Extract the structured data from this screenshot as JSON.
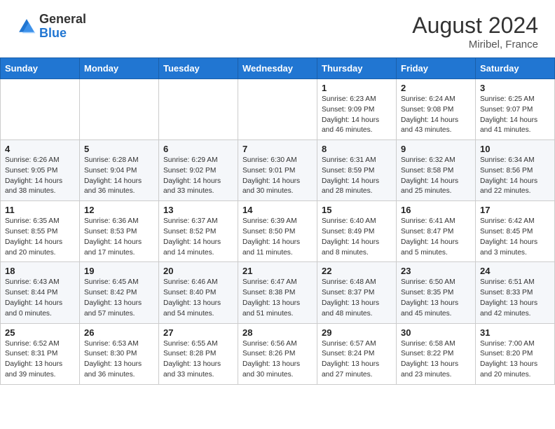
{
  "header": {
    "logo_general": "General",
    "logo_blue": "Blue",
    "month_title": "August 2024",
    "location": "Miribel, France"
  },
  "days_of_week": [
    "Sunday",
    "Monday",
    "Tuesday",
    "Wednesday",
    "Thursday",
    "Friday",
    "Saturday"
  ],
  "weeks": [
    [
      {
        "day": "",
        "content": ""
      },
      {
        "day": "",
        "content": ""
      },
      {
        "day": "",
        "content": ""
      },
      {
        "day": "",
        "content": ""
      },
      {
        "day": "1",
        "content": "Sunrise: 6:23 AM\nSunset: 9:09 PM\nDaylight: 14 hours\nand 46 minutes."
      },
      {
        "day": "2",
        "content": "Sunrise: 6:24 AM\nSunset: 9:08 PM\nDaylight: 14 hours\nand 43 minutes."
      },
      {
        "day": "3",
        "content": "Sunrise: 6:25 AM\nSunset: 9:07 PM\nDaylight: 14 hours\nand 41 minutes."
      }
    ],
    [
      {
        "day": "4",
        "content": "Sunrise: 6:26 AM\nSunset: 9:05 PM\nDaylight: 14 hours\nand 38 minutes."
      },
      {
        "day": "5",
        "content": "Sunrise: 6:28 AM\nSunset: 9:04 PM\nDaylight: 14 hours\nand 36 minutes."
      },
      {
        "day": "6",
        "content": "Sunrise: 6:29 AM\nSunset: 9:02 PM\nDaylight: 14 hours\nand 33 minutes."
      },
      {
        "day": "7",
        "content": "Sunrise: 6:30 AM\nSunset: 9:01 PM\nDaylight: 14 hours\nand 30 minutes."
      },
      {
        "day": "8",
        "content": "Sunrise: 6:31 AM\nSunset: 8:59 PM\nDaylight: 14 hours\nand 28 minutes."
      },
      {
        "day": "9",
        "content": "Sunrise: 6:32 AM\nSunset: 8:58 PM\nDaylight: 14 hours\nand 25 minutes."
      },
      {
        "day": "10",
        "content": "Sunrise: 6:34 AM\nSunset: 8:56 PM\nDaylight: 14 hours\nand 22 minutes."
      }
    ],
    [
      {
        "day": "11",
        "content": "Sunrise: 6:35 AM\nSunset: 8:55 PM\nDaylight: 14 hours\nand 20 minutes."
      },
      {
        "day": "12",
        "content": "Sunrise: 6:36 AM\nSunset: 8:53 PM\nDaylight: 14 hours\nand 17 minutes."
      },
      {
        "day": "13",
        "content": "Sunrise: 6:37 AM\nSunset: 8:52 PM\nDaylight: 14 hours\nand 14 minutes."
      },
      {
        "day": "14",
        "content": "Sunrise: 6:39 AM\nSunset: 8:50 PM\nDaylight: 14 hours\nand 11 minutes."
      },
      {
        "day": "15",
        "content": "Sunrise: 6:40 AM\nSunset: 8:49 PM\nDaylight: 14 hours\nand 8 minutes."
      },
      {
        "day": "16",
        "content": "Sunrise: 6:41 AM\nSunset: 8:47 PM\nDaylight: 14 hours\nand 5 minutes."
      },
      {
        "day": "17",
        "content": "Sunrise: 6:42 AM\nSunset: 8:45 PM\nDaylight: 14 hours\nand 3 minutes."
      }
    ],
    [
      {
        "day": "18",
        "content": "Sunrise: 6:43 AM\nSunset: 8:44 PM\nDaylight: 14 hours\nand 0 minutes."
      },
      {
        "day": "19",
        "content": "Sunrise: 6:45 AM\nSunset: 8:42 PM\nDaylight: 13 hours\nand 57 minutes."
      },
      {
        "day": "20",
        "content": "Sunrise: 6:46 AM\nSunset: 8:40 PM\nDaylight: 13 hours\nand 54 minutes."
      },
      {
        "day": "21",
        "content": "Sunrise: 6:47 AM\nSunset: 8:38 PM\nDaylight: 13 hours\nand 51 minutes."
      },
      {
        "day": "22",
        "content": "Sunrise: 6:48 AM\nSunset: 8:37 PM\nDaylight: 13 hours\nand 48 minutes."
      },
      {
        "day": "23",
        "content": "Sunrise: 6:50 AM\nSunset: 8:35 PM\nDaylight: 13 hours\nand 45 minutes."
      },
      {
        "day": "24",
        "content": "Sunrise: 6:51 AM\nSunset: 8:33 PM\nDaylight: 13 hours\nand 42 minutes."
      }
    ],
    [
      {
        "day": "25",
        "content": "Sunrise: 6:52 AM\nSunset: 8:31 PM\nDaylight: 13 hours\nand 39 minutes."
      },
      {
        "day": "26",
        "content": "Sunrise: 6:53 AM\nSunset: 8:30 PM\nDaylight: 13 hours\nand 36 minutes."
      },
      {
        "day": "27",
        "content": "Sunrise: 6:55 AM\nSunset: 8:28 PM\nDaylight: 13 hours\nand 33 minutes."
      },
      {
        "day": "28",
        "content": "Sunrise: 6:56 AM\nSunset: 8:26 PM\nDaylight: 13 hours\nand 30 minutes."
      },
      {
        "day": "29",
        "content": "Sunrise: 6:57 AM\nSunset: 8:24 PM\nDaylight: 13 hours\nand 27 minutes."
      },
      {
        "day": "30",
        "content": "Sunrise: 6:58 AM\nSunset: 8:22 PM\nDaylight: 13 hours\nand 23 minutes."
      },
      {
        "day": "31",
        "content": "Sunrise: 7:00 AM\nSunset: 8:20 PM\nDaylight: 13 hours\nand 20 minutes."
      }
    ]
  ]
}
